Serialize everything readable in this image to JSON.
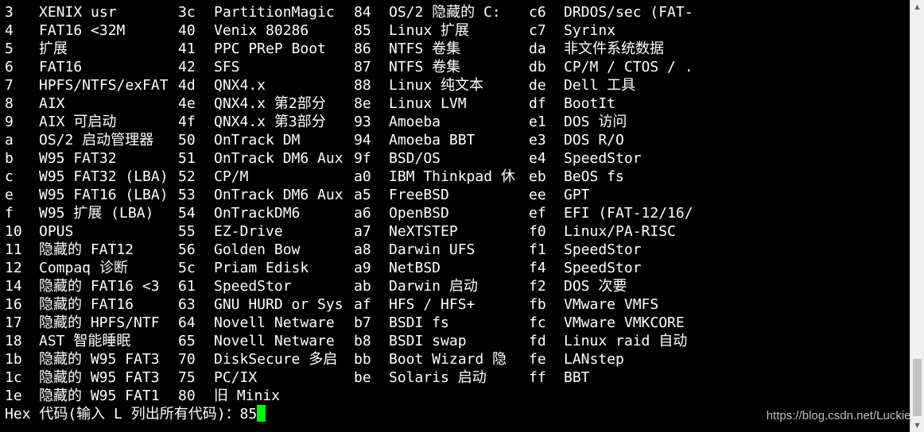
{
  "terminal": {
    "rows": [
      {
        "c0": "3",
        "n0": "XENIX usr",
        "c1": "3c",
        "n1": "PartitionMagic",
        "c2": "84",
        "n2": "OS/2 隐藏的 C:",
        "c3": "c6",
        "n3": "DRDOS/sec (FAT-"
      },
      {
        "c0": "4",
        "n0": "FAT16 <32M",
        "c1": "40",
        "n1": "Venix 80286",
        "c2": "85",
        "n2": "Linux 扩展",
        "c3": "c7",
        "n3": "Syrinx"
      },
      {
        "c0": "5",
        "n0": "扩展",
        "c1": "41",
        "n1": "PPC PReP Boot",
        "c2": "86",
        "n2": "NTFS 卷集",
        "c3": "da",
        "n3": "非文件系统数据"
      },
      {
        "c0": "6",
        "n0": "FAT16",
        "c1": "42",
        "n1": "SFS",
        "c2": "87",
        "n2": "NTFS 卷集",
        "c3": "db",
        "n3": "CP/M / CTOS / ."
      },
      {
        "c0": "7",
        "n0": "HPFS/NTFS/exFAT",
        "c1": "4d",
        "n1": "QNX4.x",
        "c2": "88",
        "n2": "Linux 纯文本",
        "c3": "de",
        "n3": "Dell 工具"
      },
      {
        "c0": "8",
        "n0": "AIX",
        "c1": "4e",
        "n1": "QNX4.x 第2部分",
        "c2": "8e",
        "n2": "Linux LVM",
        "c3": "df",
        "n3": "BootIt"
      },
      {
        "c0": "9",
        "n0": "AIX 可启动",
        "c1": "4f",
        "n1": "QNX4.x 第3部分",
        "c2": "93",
        "n2": "Amoeba",
        "c3": "e1",
        "n3": "DOS 访问"
      },
      {
        "c0": "a",
        "n0": "OS/2 启动管理器",
        "c1": "50",
        "n1": "OnTrack DM",
        "c2": "94",
        "n2": "Amoeba BBT",
        "c3": "e3",
        "n3": "DOS R/O"
      },
      {
        "c0": "b",
        "n0": "W95 FAT32",
        "c1": "51",
        "n1": "OnTrack DM6 Aux",
        "c2": "9f",
        "n2": "BSD/OS",
        "c3": "e4",
        "n3": "SpeedStor"
      },
      {
        "c0": "c",
        "n0": "W95 FAT32 (LBA)",
        "c1": "52",
        "n1": "CP/M",
        "c2": "a0",
        "n2": "IBM Thinkpad 休",
        "c3": "eb",
        "n3": "BeOS fs"
      },
      {
        "c0": "e",
        "n0": "W95 FAT16 (LBA)",
        "c1": "53",
        "n1": "OnTrack DM6 Aux",
        "c2": "a5",
        "n2": "FreeBSD",
        "c3": "ee",
        "n3": "GPT"
      },
      {
        "c0": "f",
        "n0": "W95 扩展 (LBA)",
        "c1": "54",
        "n1": "OnTrackDM6",
        "c2": "a6",
        "n2": "OpenBSD",
        "c3": "ef",
        "n3": "EFI (FAT-12/16/"
      },
      {
        "c0": "10",
        "n0": "OPUS",
        "c1": "55",
        "n1": "EZ-Drive",
        "c2": "a7",
        "n2": "NeXTSTEP",
        "c3": "f0",
        "n3": "Linux/PA-RISC"
      },
      {
        "c0": "11",
        "n0": "隐藏的 FAT12",
        "c1": "56",
        "n1": "Golden Bow",
        "c2": "a8",
        "n2": "Darwin UFS",
        "c3": "f1",
        "n3": "SpeedStor"
      },
      {
        "c0": "12",
        "n0": "Compaq 诊断",
        "c1": "5c",
        "n1": "Priam Edisk",
        "c2": "a9",
        "n2": "NetBSD",
        "c3": "f4",
        "n3": "SpeedStor"
      },
      {
        "c0": "14",
        "n0": "隐藏的 FAT16 <3",
        "c1": "61",
        "n1": "SpeedStor",
        "c2": "ab",
        "n2": "Darwin 启动",
        "c3": "f2",
        "n3": "DOS 次要"
      },
      {
        "c0": "16",
        "n0": "隐藏的 FAT16",
        "c1": "63",
        "n1": "GNU HURD or Sys",
        "c2": "af",
        "n2": "HFS / HFS+",
        "c3": "fb",
        "n3": "VMware VMFS"
      },
      {
        "c0": "17",
        "n0": "隐藏的 HPFS/NTF",
        "c1": "64",
        "n1": "Novell Netware",
        "c2": "b7",
        "n2": "BSDI fs",
        "c3": "fc",
        "n3": "VMware VMKCORE"
      },
      {
        "c0": "18",
        "n0": "AST 智能睡眠",
        "c1": "65",
        "n1": "Novell Netware",
        "c2": "b8",
        "n2": "BSDI swap",
        "c3": "fd",
        "n3": "Linux raid 自动"
      },
      {
        "c0": "1b",
        "n0": "隐藏的 W95 FAT3",
        "c1": "70",
        "n1": "DiskSecure 多启",
        "c2": "bb",
        "n2": "Boot Wizard 隐",
        "c3": "fe",
        "n3": "LANstep"
      },
      {
        "c0": "1c",
        "n0": "隐藏的 W95 FAT3",
        "c1": "75",
        "n1": "PC/IX",
        "c2": "be",
        "n2": "Solaris 启动",
        "c3": "ff",
        "n3": "BBT"
      },
      {
        "c0": "1e",
        "n0": "隐藏的 W95 FAT1",
        "c1": "80",
        "n1": "旧 Minix",
        "c2": "",
        "n2": "",
        "c3": "",
        "n3": ""
      }
    ],
    "prompt": "Hex 代码(输入 L 列出所有代码)：",
    "input_value": "85",
    "cursor_color": "#00ff00"
  },
  "watermark": "https://blog.csdn.net/Luckiers",
  "scrollbar": {
    "up_icon": "▲",
    "down_icon": "▼"
  }
}
